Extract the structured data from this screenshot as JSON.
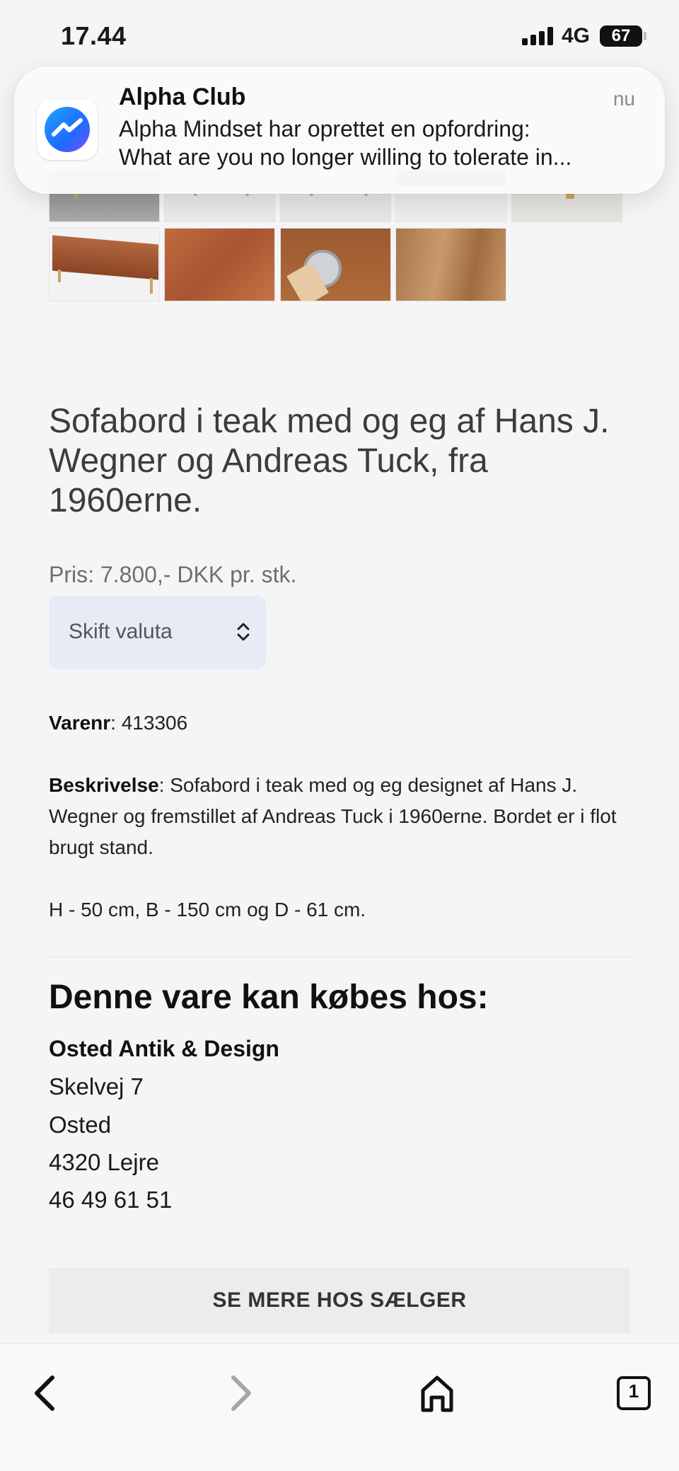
{
  "status_bar": {
    "time": "17.44",
    "network": "4G",
    "battery": "67"
  },
  "notification": {
    "app": "Alpha Club",
    "time": "nu",
    "line1": "Alpha Mindset har oprettet en opfordring:",
    "line2": "What are you no longer willing to tolerate in...",
    "icon": "messenger-icon"
  },
  "product": {
    "title": "Sofabord i teak med og eg af Hans J. Wegner og Andreas Tuck, fra 1960erne.",
    "price": "Pris: 7.800,- DKK pr. stk.",
    "currency_select": "Skift valuta",
    "varenr_label": "Varenr",
    "varenr_value": ": 413306",
    "description_label": "Beskrivelse",
    "description_text": ": Sofabord i teak med og eg designet af Hans J. Wegner og fremstillet af Andreas Tuck i 1960erne. Bordet er i flot brugt stand.",
    "dimensions": "H - 50 cm, B - 150 cm og D - 61 cm."
  },
  "seller": {
    "heading": "Denne vare kan købes hos:",
    "name": "Osted Antik & Design",
    "street": "Skelvej 7",
    "town": "Osted",
    "city": "4320 Lejre",
    "phone": "46 49 61 51",
    "cta": "SE MERE HOS SÆLGER"
  },
  "bottom_bar": {
    "tabs_count": "1"
  },
  "colors": {
    "page_bg": "#f5f5f7",
    "select_bg": "#e6ebf6",
    "teak": "#b0603a"
  }
}
